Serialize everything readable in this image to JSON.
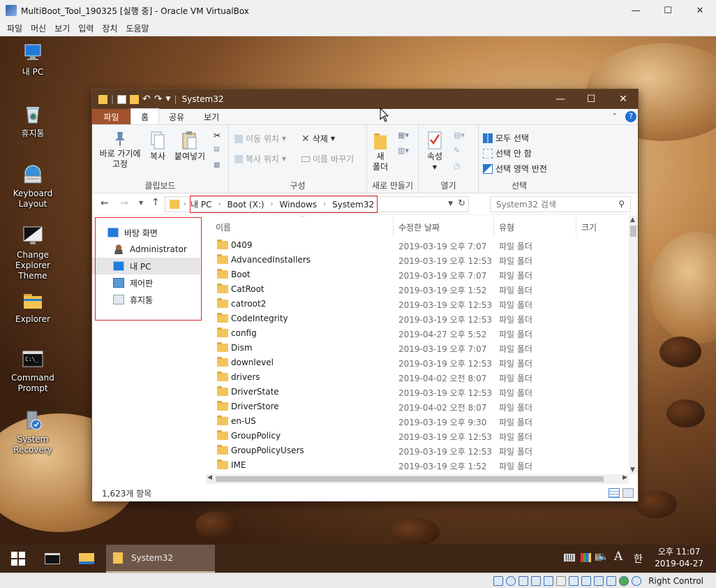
{
  "vbox": {
    "title": "MultiBoot_Tool_190325 [실행 중] - Oracle VM VirtualBox",
    "menu": [
      "파일",
      "머신",
      "보기",
      "입력",
      "장치",
      "도움말"
    ],
    "status_right": "Right Control"
  },
  "desktop_icons": [
    {
      "label": "내 PC",
      "icon": "pc-icon"
    },
    {
      "label": "휴지통",
      "icon": "recycle-bin-icon"
    },
    {
      "label": "Keyboard Layout",
      "icon": "keyboard-icon"
    },
    {
      "label": "Change Explorer Theme",
      "icon": "monitor-theme-icon"
    },
    {
      "label": "Explorer",
      "icon": "folder-icon"
    },
    {
      "label": "Command Prompt",
      "icon": "terminal-icon"
    },
    {
      "label": "System Recovery",
      "icon": "system-recovery-icon"
    }
  ],
  "explorer": {
    "title": "System32",
    "tabs": [
      "파일",
      "홈",
      "공유",
      "보기"
    ],
    "ribbon": {
      "clipboard": {
        "label": "클립보드",
        "pin": "바로 가기에",
        "pin2": "고정",
        "copy": "복사",
        "paste": "붙여넣기"
      },
      "organize": {
        "label": "구성",
        "move": "이동 위치",
        "copy_to": "복사 위치",
        "delete": "삭제",
        "rename": "이름 바꾸기"
      },
      "new": {
        "label": "새로 만들기",
        "folder": "새",
        "folder2": "폴더"
      },
      "open": {
        "label": "열기",
        "properties": "속성"
      },
      "select": {
        "label": "선택",
        "all": "모두 선택",
        "none": "선택 안 함",
        "invert": "선택 영역 반전"
      }
    },
    "address": [
      "내 PC",
      "Boot (X:)",
      "Windows",
      "System32"
    ],
    "search_placeholder": "System32 검색",
    "nav": [
      {
        "label": "바탕 화면",
        "icon": "desktop-icon"
      },
      {
        "label": "Administrator",
        "icon": "user-icon"
      },
      {
        "label": "내 PC",
        "icon": "pc-icon",
        "selected": true
      },
      {
        "label": "제어판",
        "icon": "control-panel-icon"
      },
      {
        "label": "휴지통",
        "icon": "recycle-bin-icon"
      }
    ],
    "columns": [
      "이름",
      "수정한 날짜",
      "유형",
      "크기"
    ],
    "files": [
      {
        "name": "0409",
        "date": "2019-03-19 오후 7:07",
        "type": "파일 폴더"
      },
      {
        "name": "AdvancedInstallers",
        "date": "2019-03-19 오후 12:53",
        "type": "파일 폴더"
      },
      {
        "name": "Boot",
        "date": "2019-03-19 오후 7:07",
        "type": "파일 폴더"
      },
      {
        "name": "CatRoot",
        "date": "2019-03-19 오후 1:52",
        "type": "파일 폴더"
      },
      {
        "name": "catroot2",
        "date": "2019-03-19 오후 12:53",
        "type": "파일 폴더"
      },
      {
        "name": "CodeIntegrity",
        "date": "2019-03-19 오후 12:53",
        "type": "파일 폴더"
      },
      {
        "name": "config",
        "date": "2019-04-27 오후 5:52",
        "type": "파일 폴더"
      },
      {
        "name": "Dism",
        "date": "2019-03-19 오후 7:07",
        "type": "파일 폴더"
      },
      {
        "name": "downlevel",
        "date": "2019-03-19 오후 12:53",
        "type": "파일 폴더"
      },
      {
        "name": "drivers",
        "date": "2019-04-02 오전 8:07",
        "type": "파일 폴더"
      },
      {
        "name": "DriverState",
        "date": "2019-03-19 오후 12:53",
        "type": "파일 폴더"
      },
      {
        "name": "DriverStore",
        "date": "2019-04-02 오전 8:07",
        "type": "파일 폴더"
      },
      {
        "name": "en-US",
        "date": "2019-03-19 오후 9:30",
        "type": "파일 폴더"
      },
      {
        "name": "GroupPolicy",
        "date": "2019-03-19 오후 12:53",
        "type": "파일 폴더"
      },
      {
        "name": "GroupPolicyUsers",
        "date": "2019-03-19 오후 12:53",
        "type": "파일 폴더"
      },
      {
        "name": "IME",
        "date": "2019-03-19 오후 1:52",
        "type": "파일 폴더"
      }
    ],
    "status": "1,623개 항목"
  },
  "taskbar": {
    "active_window": "System32",
    "ime_letter": "A",
    "ime_lang": "한",
    "time": "오후 11:07",
    "date": "2019-04-27"
  }
}
